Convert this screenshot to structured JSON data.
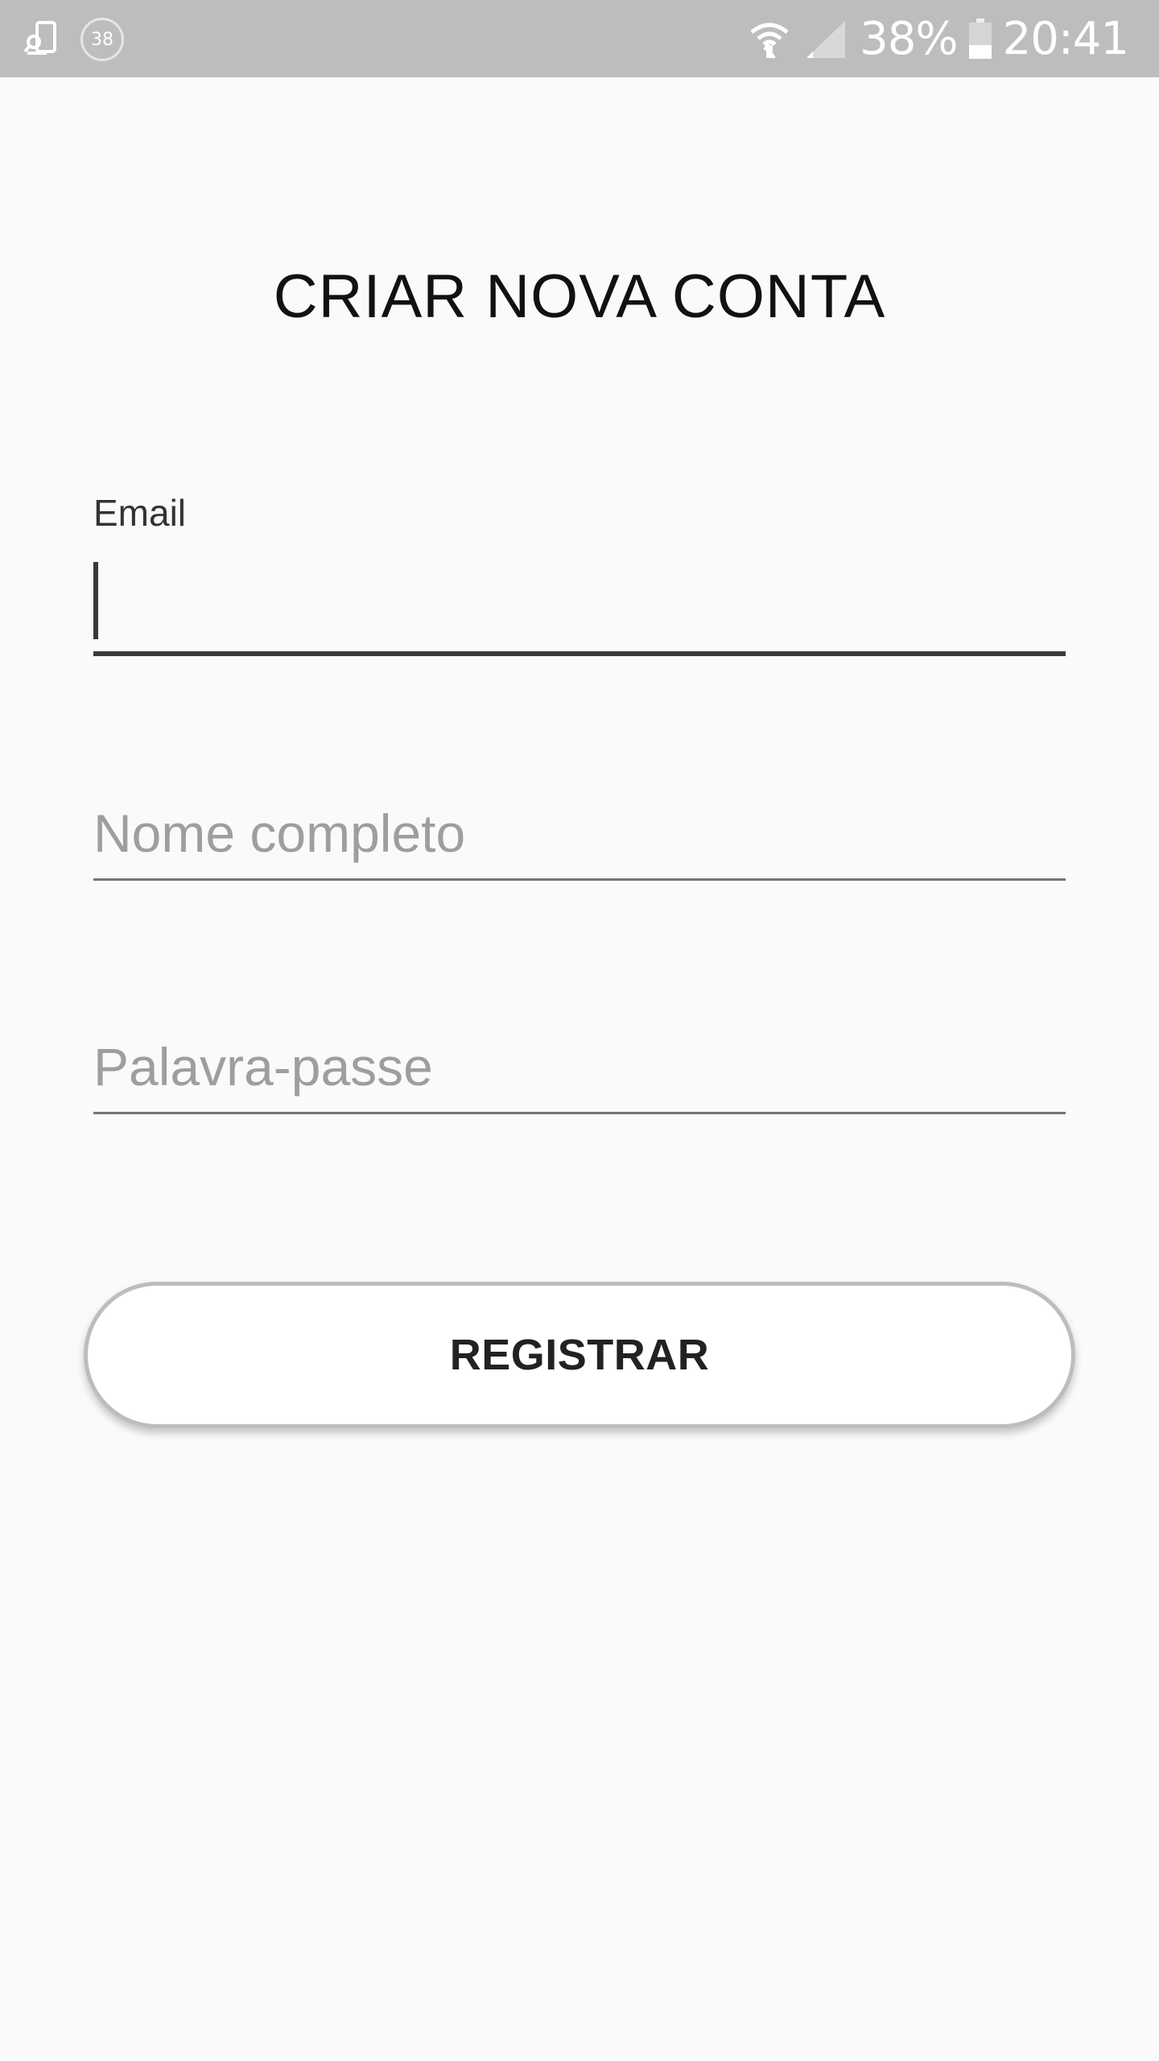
{
  "status_bar": {
    "notification_badge": "38",
    "battery_text": "38%",
    "battery_level": 0.38,
    "time": "20:41",
    "icons": [
      "remote-device-icon",
      "progress-badge-icon",
      "wifi-icon",
      "cell-signal-icon",
      "battery-icon"
    ]
  },
  "title": "CRIAR NOVA CONTA",
  "form": {
    "email": {
      "label": "Email",
      "value": "",
      "placeholder": ""
    },
    "name": {
      "value": "",
      "placeholder": "Nome completo"
    },
    "password": {
      "value": "",
      "placeholder": "Palavra-passe"
    }
  },
  "register_button_label": "REGISTRAR",
  "colors": {
    "status_bar_bg": "#bdbdbd",
    "page_bg": "#fafafa",
    "active_underline": "#3a3a3a",
    "inactive_underline": "#757575",
    "placeholder": "#9e9e9e",
    "button_border": "#bdbdbd"
  }
}
